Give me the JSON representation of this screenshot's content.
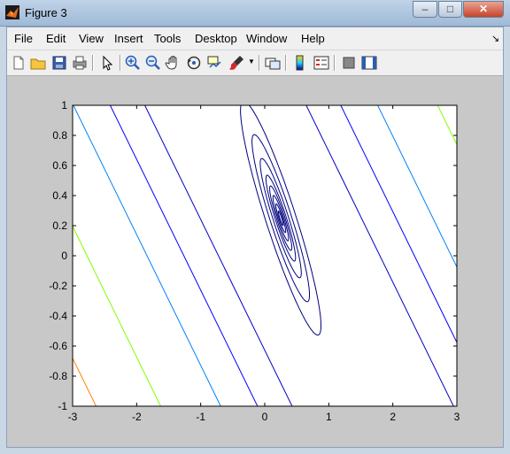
{
  "window": {
    "title": "Figure 3",
    "minimize": "–",
    "maximize": "□",
    "close": "✕"
  },
  "menu": [
    "File",
    "Edit",
    "View",
    "Insert",
    "Tools",
    "Desktop",
    "Window",
    "Help"
  ],
  "toolbar": [
    "new-figure",
    "open-file",
    "save",
    "print",
    "edit-plot-arrow",
    "zoom-in",
    "zoom-out",
    "pan",
    "rotate-3d",
    "data-cursor",
    "brush",
    "link-plot",
    "colorbar",
    "legend",
    "hide-plot-tools",
    "show-plot-tools"
  ],
  "colors": {
    "figure_bg": "#c8c8c8",
    "axes_bg": "#ffffff"
  },
  "chart_data": {
    "type": "contour",
    "xlim": [
      -3,
      3
    ],
    "ylim": [
      -1,
      1
    ],
    "xticks": [
      "-3",
      "-2",
      "-1",
      "0",
      "1",
      "2",
      "3"
    ],
    "yticks": [
      "-1",
      "-0.8",
      "-0.6",
      "-0.4",
      "-0.2",
      "0",
      "0.2",
      "0.4",
      "0.6",
      "0.8",
      "1"
    ],
    "grid": false,
    "center": [
      0.25,
      0.25
    ],
    "ellipse_levels": [
      {
        "a": 0.06,
        "b": 0.012,
        "color": "#00007f"
      },
      {
        "a": 0.12,
        "b": 0.024,
        "color": "#00007f"
      },
      {
        "a": 0.19,
        "b": 0.038,
        "color": "#00007f"
      },
      {
        "a": 0.27,
        "b": 0.054,
        "color": "#00007f"
      },
      {
        "a": 0.36,
        "b": 0.072,
        "color": "#00007f"
      },
      {
        "a": 0.5,
        "b": 0.1,
        "color": "#00007f"
      },
      {
        "a": 0.7,
        "b": 0.14,
        "color": "#00007f"
      },
      {
        "a": 0.98,
        "b": 0.196,
        "color": "#00007f"
      }
    ],
    "line_levels": [
      {
        "offset": -1.75,
        "color": "#0000c8"
      },
      {
        "offset": 1.75,
        "color": "#0000c8"
      },
      {
        "offset": -2.5,
        "color": "#0000ff"
      },
      {
        "offset": 2.5,
        "color": "#0000ff"
      },
      {
        "offset": -3.3,
        "color": "#0080ff"
      },
      {
        "offset": 3.3,
        "color": "#0080ff"
      },
      {
        "offset": -4.6,
        "color": "#80ff00"
      },
      {
        "offset": 4.6,
        "color": "#80ff00"
      },
      {
        "offset": -6.0,
        "color": "#ff8000"
      },
      {
        "offset": -6.8,
        "color": "#800000"
      }
    ]
  }
}
